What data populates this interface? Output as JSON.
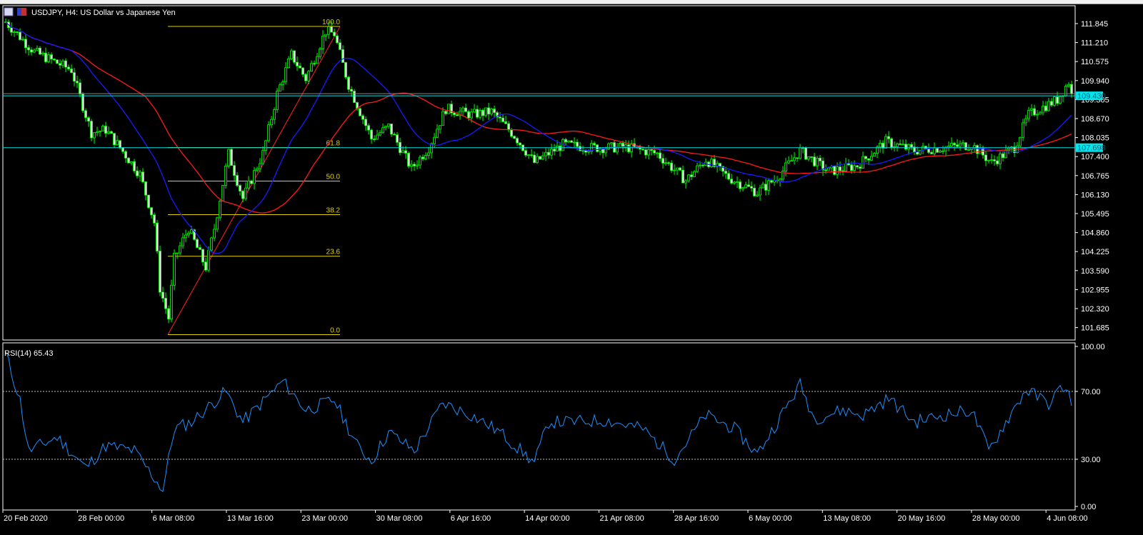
{
  "title": "USDJPY, H4:  US Dollar vs Japanese Yen",
  "rsi_label": "RSI(14) 65.43",
  "colors": {
    "bull": "#00ff00",
    "ma_fast": "#1a1aff",
    "ma_slow": "#ff1a1a",
    "fib": "#e0d000",
    "hline": "#00e0e0",
    "rsi": "#1e90ff"
  },
  "chart_data": {
    "type": "candlestick",
    "symbol": "USDJPY",
    "timeframe": "H4",
    "price_ticks": [
      "111.845",
      "111.210",
      "110.575",
      "109.940",
      "109.305",
      "108.670",
      "108.035",
      "107.400",
      "106.765",
      "106.130",
      "105.495",
      "104.860",
      "104.225",
      "103.590",
      "102.955",
      "102.320",
      "101.685"
    ],
    "ylim": [
      101.43,
      112.09
    ],
    "bid_label": "109.430",
    "bid": 109.43,
    "hline_label": "107.698",
    "hline": 107.698,
    "fib_levels": [
      {
        "label": "100.0",
        "price": 111.75
      },
      {
        "label": "61.8",
        "price": 107.7
      },
      {
        "label": "50.0",
        "price": 106.58
      },
      {
        "label": "38.2",
        "price": 105.46
      },
      {
        "label": "23.6",
        "price": 104.07
      },
      {
        "label": "0.0",
        "price": 101.45
      }
    ],
    "bars": 373,
    "price_keypoints": [
      [
        0,
        111.9
      ],
      [
        10,
        110.9
      ],
      [
        23,
        110.3
      ],
      [
        30,
        108.2
      ],
      [
        35,
        108.3
      ],
      [
        40,
        107.7
      ],
      [
        47,
        106.8
      ],
      [
        52,
        105.2
      ],
      [
        54,
        103
      ],
      [
        57,
        102
      ],
      [
        59,
        104
      ],
      [
        64,
        105
      ],
      [
        70,
        103.7
      ],
      [
        73,
        105
      ],
      [
        78,
        107.5
      ],
      [
        83,
        106
      ],
      [
        90,
        107.5
      ],
      [
        95,
        109.5
      ],
      [
        100,
        110.8
      ],
      [
        105,
        110
      ],
      [
        112,
        111.6
      ],
      [
        115,
        111.5
      ],
      [
        120,
        109.8
      ],
      [
        128,
        108
      ],
      [
        134,
        108.4
      ],
      [
        142,
        107
      ],
      [
        148,
        107.7
      ],
      [
        154,
        109
      ],
      [
        163,
        108.8
      ],
      [
        170,
        108.9
      ],
      [
        178,
        108.1
      ],
      [
        185,
        107.2
      ],
      [
        195,
        107.8
      ],
      [
        205,
        107.7
      ],
      [
        218,
        107.7
      ],
      [
        228,
        107.5
      ],
      [
        238,
        106.6
      ],
      [
        245,
        107.3
      ],
      [
        253,
        106.7
      ],
      [
        263,
        106.2
      ],
      [
        270,
        106.7
      ],
      [
        278,
        107.6
      ],
      [
        288,
        106.9
      ],
      [
        298,
        107.1
      ],
      [
        308,
        107.9
      ],
      [
        318,
        107.6
      ],
      [
        328,
        107.7
      ],
      [
        338,
        107.8
      ],
      [
        345,
        107.2
      ],
      [
        353,
        107.7
      ],
      [
        358,
        108.8
      ],
      [
        368,
        109.3
      ],
      [
        372,
        109.9
      ],
      [
        373,
        109.45
      ]
    ],
    "rsi_ticks": [
      "100.00",
      "70.00",
      "30.00",
      "0.00"
    ],
    "rsi_keypoints": [
      [
        0,
        92
      ],
      [
        5,
        65
      ],
      [
        8,
        35
      ],
      [
        18,
        43
      ],
      [
        28,
        25
      ],
      [
        35,
        38
      ],
      [
        45,
        35
      ],
      [
        55,
        12
      ],
      [
        59,
        48
      ],
      [
        65,
        52
      ],
      [
        77,
        70
      ],
      [
        83,
        52
      ],
      [
        97,
        76
      ],
      [
        105,
        59
      ],
      [
        115,
        65
      ],
      [
        123,
        38
      ],
      [
        128,
        29
      ],
      [
        134,
        46
      ],
      [
        143,
        35
      ],
      [
        153,
        63
      ],
      [
        163,
        56
      ],
      [
        173,
        46
      ],
      [
        185,
        28
      ],
      [
        190,
        52
      ],
      [
        198,
        52
      ],
      [
        210,
        53
      ],
      [
        223,
        48
      ],
      [
        234,
        30
      ],
      [
        245,
        56
      ],
      [
        255,
        48
      ],
      [
        263,
        33
      ],
      [
        270,
        52
      ],
      [
        278,
        74
      ],
      [
        283,
        54
      ],
      [
        293,
        59
      ],
      [
        300,
        56
      ],
      [
        309,
        66
      ],
      [
        318,
        52
      ],
      [
        328,
        56
      ],
      [
        338,
        59
      ],
      [
        344,
        35
      ],
      [
        350,
        52
      ],
      [
        357,
        71
      ],
      [
        365,
        63
      ],
      [
        370,
        73
      ],
      [
        373,
        65
      ]
    ],
    "time_labels": [
      "20 Feb 2020",
      "28 Feb 00:00",
      "6 Mar 08:00",
      "13 Mar 16:00",
      "23 Mar 00:00",
      "30 Mar 08:00",
      "6 Apr 16:00",
      "14 Apr 00:00",
      "21 Apr 08:00",
      "28 Apr 16:00",
      "6 May 00:00",
      "13 May 08:00",
      "20 May 16:00",
      "28 May 00:00",
      "4 Jun 08:00"
    ]
  }
}
